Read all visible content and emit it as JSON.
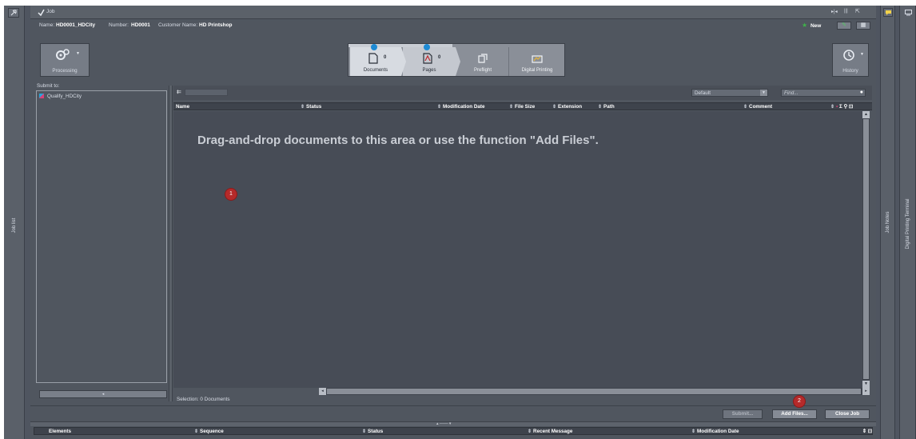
{
  "window": {
    "title": "Job"
  },
  "sidebar_left": {
    "label": "Job list"
  },
  "sidebar_right": {
    "notes_label": "Job Notes",
    "terminal_label": "Digital Printing Terminal"
  },
  "job_info": {
    "name_label": "Name:",
    "name_value": "HD0001_HDCity",
    "number_label": "Number:",
    "number_value": "HD0001",
    "customer_label": "Customer Name:",
    "customer_value": "HD Printshop",
    "new_label": "New"
  },
  "toolbar": {
    "processing_label": "Processing",
    "history_label": "History"
  },
  "workflow": {
    "steps": [
      {
        "label": "Documents",
        "count": "0"
      },
      {
        "label": "Pages",
        "count": "0"
      },
      {
        "label": "Preflight",
        "count": ""
      },
      {
        "label": "Digital Printing",
        "count": ""
      }
    ]
  },
  "submit_panel": {
    "title": "Submit to:",
    "items": [
      {
        "label": "Qualify_HDCity"
      }
    ]
  },
  "documents": {
    "filter_value": "Default",
    "find_placeholder": "Find...",
    "columns": [
      "Name",
      "Status",
      "Modification Date",
      "File Size",
      "Extension",
      "Path",
      "Comment"
    ],
    "empty_message": "Drag-and-drop documents to this area or use the function \"Add Files\".",
    "selection_text": "Selection: 0 Documents"
  },
  "buttons": {
    "submit": "Submit...",
    "add_files": "Add Files...",
    "close_job": "Close Job"
  },
  "badges": {
    "one": "1",
    "two": "2"
  },
  "bottom_table": {
    "columns": [
      "Elements",
      "Sequence",
      "Status",
      "Recent Message",
      "Modification Date"
    ]
  },
  "colors": {
    "background": "#4f5560",
    "content": "#474c56",
    "accent_red": "#b52a2a"
  }
}
